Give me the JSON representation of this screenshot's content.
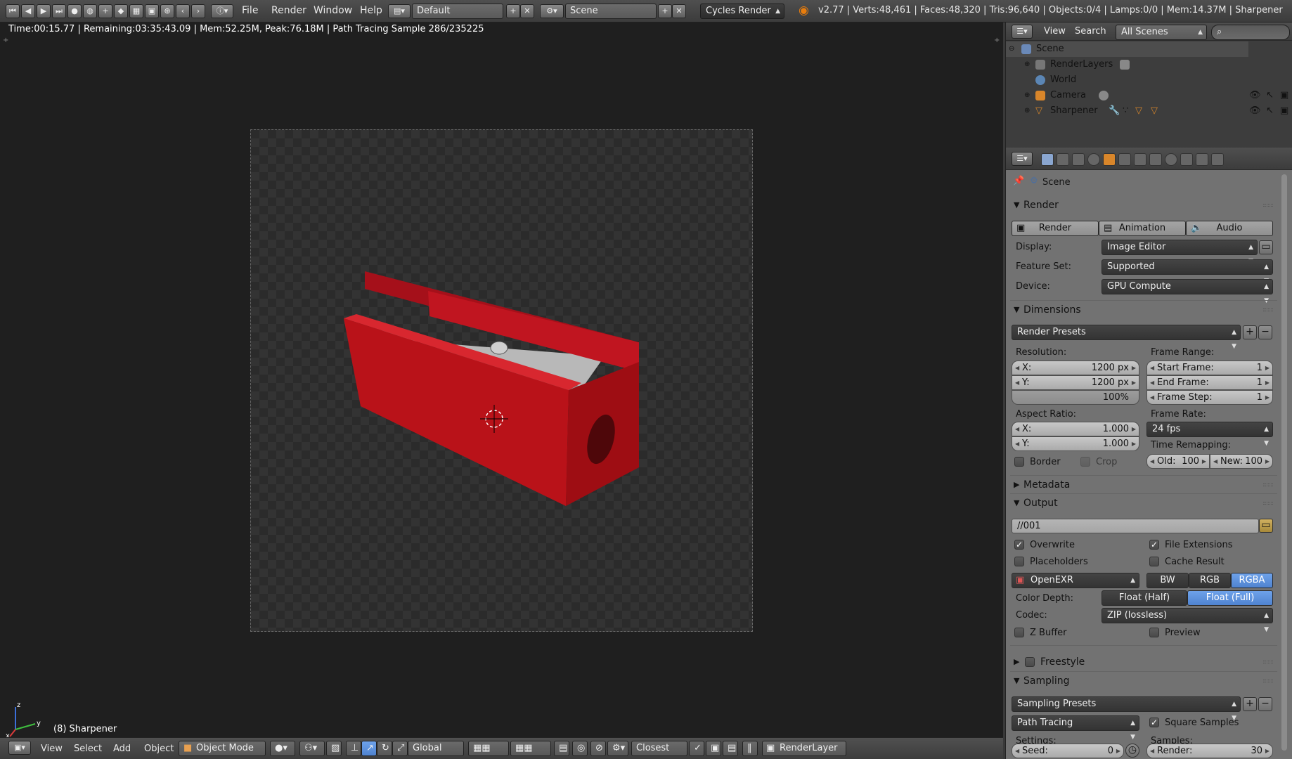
{
  "topbar": {
    "menus": [
      "File",
      "Render",
      "Window",
      "Help"
    ],
    "layout_value": "Default",
    "scene_value": "Scene",
    "engine_value": "Cycles Render",
    "stats": "v2.77 | Verts:48,461 | Faces:48,320 | Tris:96,640 | Objects:0/4 | Lamps:0/0 | Mem:14.37M | Sharpener",
    "brand_color": "#e87d0d"
  },
  "viewport": {
    "status": "Time:00:15.77 | Remaining:03:35:43.09 | Mem:52.25M, Peak:76.18M | Path Tracing Sample 286/235225",
    "object_label": "(8) Sharpener",
    "axis_x": "x",
    "axis_y": "y",
    "axis_z": "z",
    "object_color": "#c7161e"
  },
  "bottombar": {
    "menus": [
      "View",
      "Select",
      "Add",
      "Object"
    ],
    "mode": "Object Mode",
    "orientation": "Global",
    "snap": "Closest",
    "render_layer": "RenderLayer"
  },
  "outliner": {
    "view": "View",
    "search": "Search",
    "scenes": "All Scenes",
    "items": [
      "Scene",
      "RenderLayers",
      "World",
      "Camera",
      "Sharpener"
    ]
  },
  "props": {
    "context": "Scene",
    "render": {
      "title": "Render",
      "buttons": [
        "Render",
        "Animation",
        "Audio"
      ],
      "display_label": "Display:",
      "display_value": "Image Editor",
      "featureset_label": "Feature Set:",
      "featureset_value": "Supported",
      "device_label": "Device:",
      "device_value": "GPU Compute"
    },
    "dimensions": {
      "title": "Dimensions",
      "presets": "Render Presets",
      "resolution_label": "Resolution:",
      "res_x": "1200 px",
      "res_y": "1200 px",
      "res_pct": "100%",
      "x_label": "X:",
      "y_label": "Y:",
      "frame_range_label": "Frame Range:",
      "start_label": "Start Frame:",
      "start_value": "1",
      "end_label": "End Frame:",
      "end_value": "1",
      "step_label": "Frame Step:",
      "step_value": "1",
      "aspect_label": "Aspect Ratio:",
      "aspect_x": "1.000",
      "aspect_y": "1.000",
      "frame_rate_label": "Frame Rate:",
      "frame_rate": "24 fps",
      "border": "Border",
      "crop": "Crop",
      "time_remap_label": "Time Remapping:",
      "old_label": "Old:",
      "old_value": "100",
      "new_label": "New:",
      "new_value": "100"
    },
    "metadata": {
      "title": "Metadata"
    },
    "output": {
      "title": "Output",
      "path": "//001",
      "overwrite": "Overwrite",
      "file_extensions": "File Extensions",
      "placeholders": "Placeholders",
      "cache_result": "Cache Result",
      "format": "OpenEXR",
      "bw": "BW",
      "rgb": "RGB",
      "rgba": "RGBA",
      "color_depth_label": "Color Depth:",
      "float_half": "Float (Half)",
      "float_full": "Float (Full)",
      "codec_label": "Codec:",
      "codec": "ZIP (lossless)",
      "zbuffer": "Z Buffer",
      "preview": "Preview"
    },
    "freestyle": {
      "title": "Freestyle"
    },
    "sampling": {
      "title": "Sampling",
      "presets": "Sampling Presets",
      "integrator": "Path Tracing",
      "square_samples": "Square Samples",
      "settings_label": "Settings:",
      "samples_label": "Samples:",
      "seed_label": "Seed:",
      "seed_value": "0",
      "render_label": "Render:",
      "render_value": "30"
    },
    "accent_color": "#5680c2"
  }
}
